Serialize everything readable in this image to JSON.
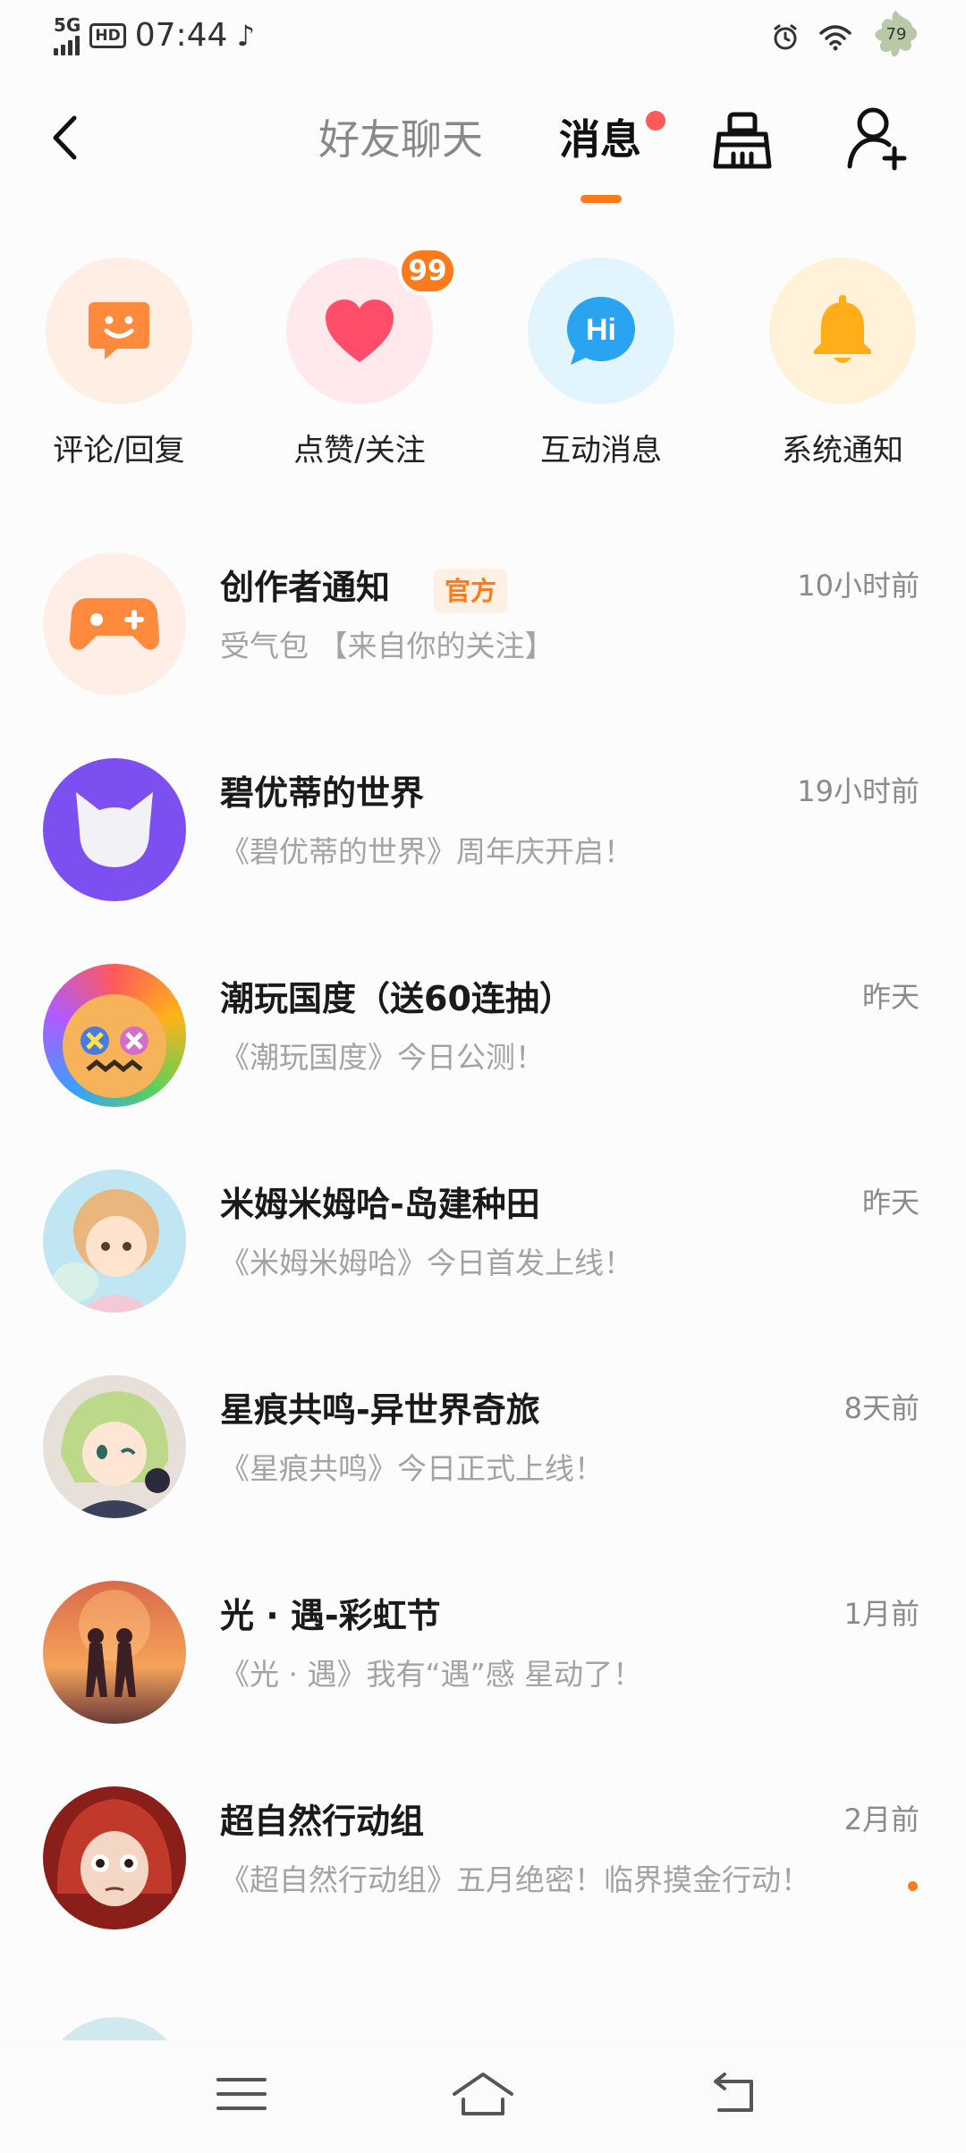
{
  "status_bar": {
    "network": "5G",
    "hd": "HD",
    "time": "07:44",
    "battery": "79"
  },
  "header": {
    "tab_friends": "好友聊天",
    "tab_messages": "消息"
  },
  "quick_entries": [
    {
      "label": "评论/回复",
      "icon": "smile-chat-icon",
      "color": "#ff8a3d",
      "bg": "#ffeee3"
    },
    {
      "label": "点赞/关注",
      "icon": "heart-icon",
      "color": "#ff4d6a",
      "bg": "#ffe9ec",
      "badge": "99"
    },
    {
      "label": "互动消息",
      "icon": "hi-bubble-icon",
      "color": "#2aa3f0",
      "bg": "#e2f4fd"
    },
    {
      "label": "系统通知",
      "icon": "bell-icon",
      "color": "#ffae1a",
      "bg": "#fff2d8"
    }
  ],
  "messages": [
    {
      "title": "创作者通知",
      "tag": "官方",
      "subtitle": "受气包  【来自你的关注】",
      "time": "10小时前",
      "avatar": "gamepad-icon"
    },
    {
      "title": "碧优蒂的世界",
      "subtitle": "《碧优蒂的世界》周年庆开启！",
      "time": "19小时前",
      "avatar": "cat-mascot-icon"
    },
    {
      "title": "潮玩国度（送60连抽）",
      "subtitle": "《潮玩国度》今日公测！",
      "time": "昨天",
      "avatar": "toy-character-avatar"
    },
    {
      "title": "米姆米姆哈-岛建种田",
      "subtitle": "《米姆米姆哈》今日首发上线！",
      "time": "昨天",
      "avatar": "anime-girl-avatar"
    },
    {
      "title": "星痕共鸣-异世界奇旅",
      "subtitle": "《星痕共鸣》今日正式上线！",
      "time": "8天前",
      "avatar": "green-hair-girl-avatar"
    },
    {
      "title": "光 · 遇-彩虹节",
      "subtitle": "《光 · 遇》我有“遇”感 星动了！",
      "time": "1月前",
      "avatar": "sky-children-avatar"
    },
    {
      "title": "超自然行动组",
      "subtitle": "《超自然行动组》五月绝密！临界摸金行动！",
      "time": "2月前",
      "avatar": "red-hood-girl-avatar",
      "unread": true
    }
  ]
}
